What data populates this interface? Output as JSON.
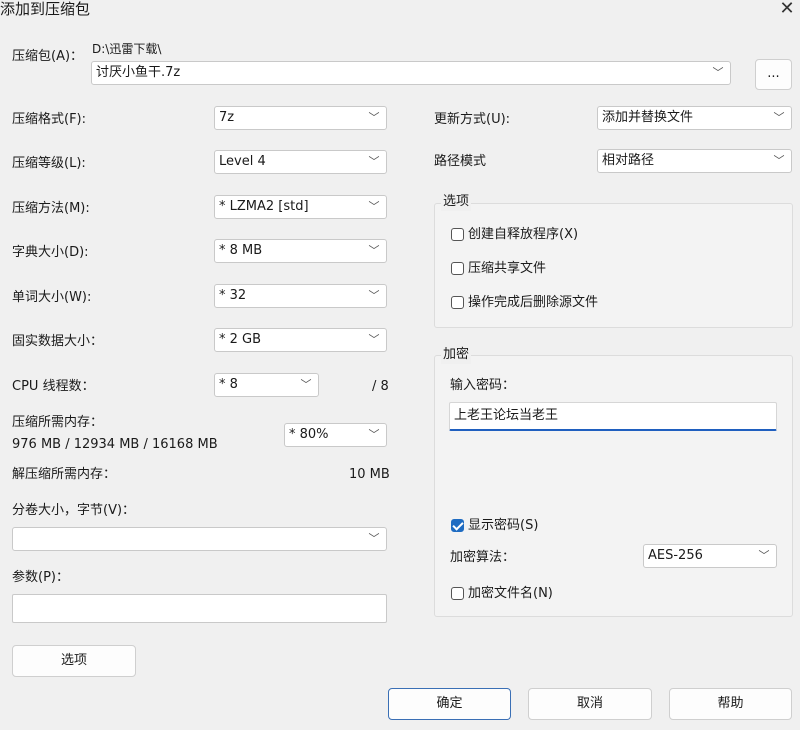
{
  "window": {
    "title": "添加到压缩包"
  },
  "archive": {
    "label": "压缩包(A)：",
    "path": "D:\\迅雷下载\\",
    "filename": "讨厌小鱼干.7z",
    "browse": "..."
  },
  "left": {
    "format": {
      "label": "压缩格式(F):",
      "value": "7z"
    },
    "level": {
      "label": "压缩等级(L):",
      "value": "Level 4"
    },
    "method": {
      "label": "压缩方法(M):",
      "value": "*  LZMA2 [std]"
    },
    "dict": {
      "label": "字典大小(D):",
      "value": "*  8 MB"
    },
    "word": {
      "label": "单词大小(W):",
      "value": "*  32"
    },
    "solid": {
      "label": "固实数据大小：",
      "value": "*  2 GB"
    },
    "threads": {
      "label": "CPU 线程数：",
      "value": "*  8",
      "total": "/ 8"
    },
    "mem_comp": {
      "label": "压缩所需内存：",
      "detail": "976 MB / 12934 MB / 16168 MB",
      "value": "* 80%"
    },
    "mem_decomp": {
      "label": "解压缩所需内存：",
      "value": "10 MB"
    },
    "volume": {
      "label": "分卷大小，字节(V)：",
      "value": ""
    },
    "params": {
      "label": "参数(P)：",
      "value": ""
    },
    "options_button": "选项"
  },
  "right": {
    "update": {
      "label": "更新方式(U):",
      "value": "添加并替换文件"
    },
    "path_mode": {
      "label": "路径模式",
      "value": "相对路径"
    },
    "options_group": {
      "title": "选项",
      "sfx": {
        "label": "创建自释放程序(X)",
        "checked": false
      },
      "shared": {
        "label": "压缩共享文件",
        "checked": false
      },
      "delete": {
        "label": "操作完成后删除源文件",
        "checked": false
      }
    },
    "encryption": {
      "title": "加密",
      "password_label": "输入密码：",
      "password_value": "上老王论坛当老王",
      "show_password": {
        "label": "显示密码(S)",
        "checked": true
      },
      "method_label": "加密算法：",
      "method_value": "AES-256",
      "encrypt_names": {
        "label": "加密文件名(N)",
        "checked": false
      }
    }
  },
  "footer": {
    "ok": "确定",
    "cancel": "取消",
    "help": "帮助"
  },
  "colors": {
    "accent": "#1f6cc2",
    "focus_underline": "#1f5fbf",
    "background": "#f0f0f0"
  }
}
